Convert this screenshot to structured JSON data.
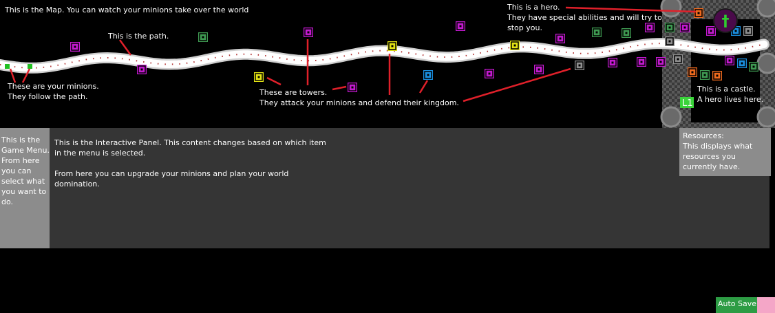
{
  "map": {
    "title_label": "This is the Map. You can watch your minions take over the world",
    "path_label": "This is the path.",
    "minions_label": "These are your minions.\nThey follow the path.",
    "towers_label": "These are towers.\nThey attack your minions and defend their kingdom.",
    "hero_label": "This is a hero.\nThey have special abilities and will try to\nstop you.",
    "castle_label": "This is a castle.\nA hero lives here.",
    "level_badge": "L1",
    "hero_symbol": "†"
  },
  "game_menu": {
    "text": "This is the Game Menu. From here you can select what you want to do."
  },
  "interactive_panel": {
    "paragraph1": "This is the Interactive Panel. This content changes based on which item in the menu is selected.",
    "paragraph2": "From here you can upgrade your minions and plan your world domination."
  },
  "resources": {
    "text": "Resources:\nThis displays what resources you currently have."
  },
  "footer": {
    "autosave_label": "Auto Save"
  },
  "colors": {
    "annotation_line": "#e0202a",
    "tower_magenta": "#c41ad0",
    "tower_green": "#3f9a52",
    "tower_yellow": "#e4e414",
    "tower_blue": "#1a8fe0",
    "tower_gray": "#8f8f8f",
    "tower_orange": "#ef6a1e",
    "minion": "#22c022",
    "hero_ring": "#4a0a4a",
    "hero_cross": "#2fcc2f"
  }
}
